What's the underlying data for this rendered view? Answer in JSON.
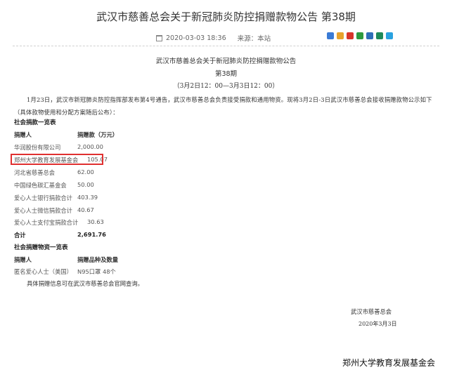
{
  "page": {
    "title": "武汉市慈善总会关于新冠肺炎防控捐赠款物公告 第38期",
    "date": "2020-03-03 18:36",
    "source": "来源：本站"
  },
  "share_icons": [
    {
      "name": "plus-share-icon",
      "color": "#3a7bd5"
    },
    {
      "name": "qzone-share-icon",
      "color": "#e8a22c"
    },
    {
      "name": "weibo-share-icon",
      "color": "#d8352a"
    },
    {
      "name": "douban-share-icon",
      "color": "#2e9a3f"
    },
    {
      "name": "renren-share-icon",
      "color": "#2f6fb8"
    },
    {
      "name": "people-share-icon",
      "color": "#1e8a5a"
    },
    {
      "name": "qq-share-icon",
      "color": "#2aa2e0"
    }
  ],
  "doc": {
    "title": "武汉市慈善总会关于新冠肺炎防控捐赠款物公告",
    "issue": "第38期",
    "period": "（3月2日12：00—3月3日12：00）",
    "intro": "1月23日，武汉市新冠肺炎防控指挥部发布第4号通告，武汉市慈善总会负责接受捐款和通用物资。现将3月2日-3日武汉市慈善总会接收捐赠款物公示如下（具体款物使用和分配方案随后公布）："
  },
  "money": {
    "heading": "社会捐款一览表",
    "col_donor": "捐赠人",
    "col_amount": "捐赠款（万元）",
    "rows": [
      {
        "donor": "华润股份有限公司",
        "amount": "2,000.00"
      },
      {
        "donor": "郑州大学教育发展基金会",
        "amount": "105.07"
      },
      {
        "donor": "河北省慈善总会",
        "amount": "62.00"
      },
      {
        "donor": "中国绿色碳汇基金会",
        "amount": "50.00"
      },
      {
        "donor": "爱心人士银行捐款合计",
        "amount": "403.39"
      },
      {
        "donor": "爱心人士微信捐款合计",
        "amount": "40.67"
      },
      {
        "donor": "爱心人士支付宝捐款合计",
        "amount": "30.63"
      }
    ],
    "total_label": "合计",
    "total_value": "2,691.76"
  },
  "goods": {
    "heading": "社会捐赠物资一览表",
    "col_donor": "捐赠人",
    "col_item": "捐赠品种及数量",
    "rows": [
      {
        "donor": "匿名爱心人士（美国）",
        "item": "N95口罩 48个"
      }
    ]
  },
  "closing": "具体捐赠信息可在武汉市慈善总会官网查询。",
  "signature": {
    "org": "武汉市慈善总会",
    "date": "2020年3月3日"
  },
  "caption": "郑州大学教育发展基金会",
  "colors": {
    "highlight": "#e03030"
  }
}
